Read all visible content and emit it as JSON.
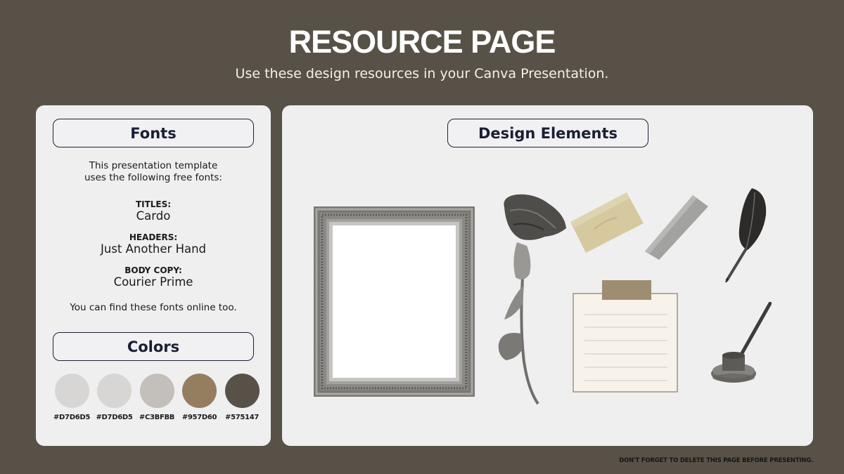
{
  "header": {
    "title": "RESOURCE PAGE",
    "subtitle": "Use these design resources in your Canva Presentation."
  },
  "fonts_panel": {
    "heading": "Fonts",
    "intro_line1": "This presentation template",
    "intro_line2": "uses the following free fonts:",
    "fonts": [
      {
        "label": "TITLES:",
        "name": "Cardo"
      },
      {
        "label": "HEADERS:",
        "name": "Just Another Hand"
      },
      {
        "label": "BODY COPY:",
        "name": "Courier Prime"
      }
    ],
    "outro": "You can find these fonts online too."
  },
  "colors_panel": {
    "heading": "Colors",
    "swatches": [
      {
        "hex": "#D7D6D5",
        "color": "#D7D6D5"
      },
      {
        "hex": "#D7D6D5",
        "color": "#D7D6D5"
      },
      {
        "hex": "#C3BFBB",
        "color": "#C3BFBB"
      },
      {
        "hex": "#957D60",
        "color": "#957D60"
      },
      {
        "hex": "#575147",
        "color": "#575147"
      }
    ]
  },
  "design_elements_panel": {
    "heading": "Design Elements",
    "elements": [
      "picture-frame",
      "dried-rose",
      "beige-tape",
      "gray-tape",
      "quill-feather",
      "lined-note-paper",
      "inkwell-with-pen"
    ]
  },
  "footer": {
    "note": "DON'T FORGET TO DELETE THIS PAGE BEFORE PRESENTING."
  },
  "theme": {
    "background": "#575147",
    "panel": "#EFEFEF",
    "heading_text": "#1A1F33"
  }
}
